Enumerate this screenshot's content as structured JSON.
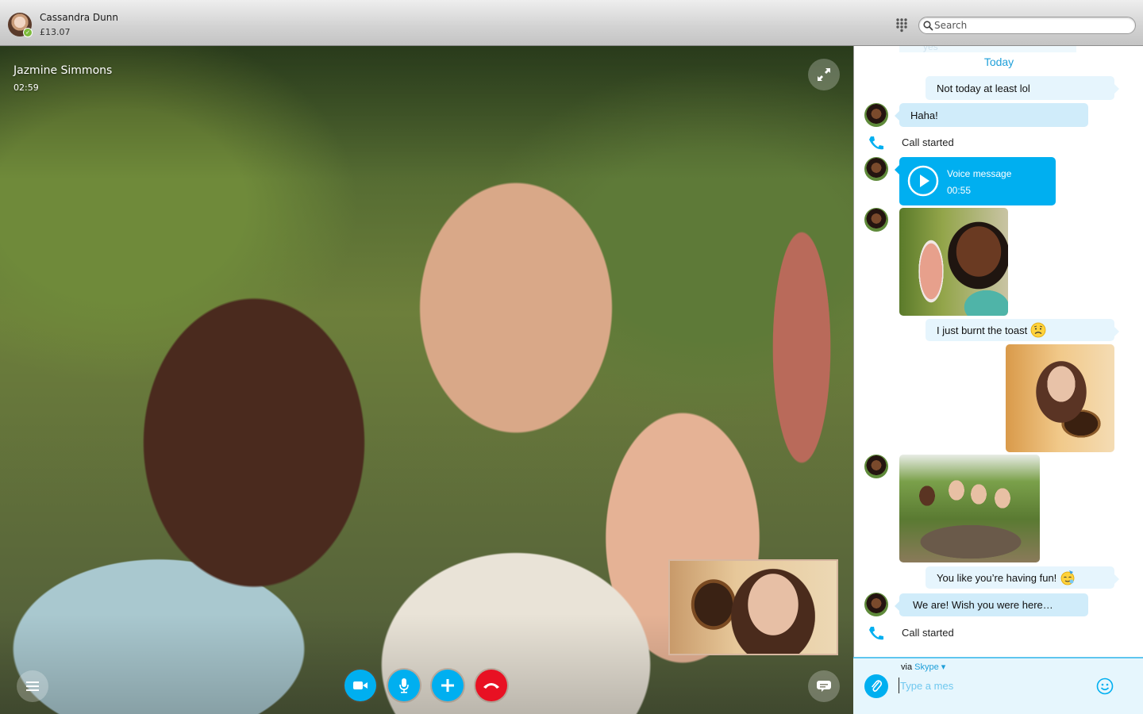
{
  "titlebar": {
    "user_name": "Cassandra Dunn",
    "credit": "£13.07",
    "presence": "online",
    "search": {
      "placeholder": "Search",
      "value": ""
    }
  },
  "call": {
    "contact_name": "Jazmine Simmons",
    "duration": "02:59",
    "controls": [
      {
        "name": "video",
        "icon": "video-camera-icon",
        "color": "#00aff0"
      },
      {
        "name": "mute",
        "icon": "microphone-icon",
        "color": "#00aff0"
      },
      {
        "name": "add",
        "icon": "plus-icon",
        "color": "#00aff0"
      },
      {
        "name": "end-call",
        "icon": "hang-up-icon",
        "color": "#e81123"
      }
    ]
  },
  "chat": {
    "previous_message_fragment": "yes",
    "date_separator": "Today",
    "messages": [
      {
        "type": "text",
        "direction": "out",
        "text": "Not today at least lol"
      },
      {
        "type": "text",
        "direction": "in",
        "text": "Haha!"
      },
      {
        "type": "call",
        "text": "Call started"
      },
      {
        "type": "voice",
        "direction": "in",
        "title": "Voice message",
        "duration": "00:55"
      },
      {
        "type": "photo",
        "direction": "in",
        "description": "woman holding champagne glass"
      },
      {
        "type": "text",
        "direction": "out",
        "text": "I just burnt the toast",
        "emoticon": "sad-face"
      },
      {
        "type": "photo",
        "direction": "out",
        "description": "woman holding burnt toast"
      },
      {
        "type": "photo",
        "direction": "in",
        "description": "four friends toasting"
      },
      {
        "type": "text",
        "direction": "out",
        "text": "You like you’re having fun!",
        "emoticon": "party-face"
      },
      {
        "type": "text",
        "direction": "in",
        "text": "We are! Wish you were here…"
      },
      {
        "type": "call",
        "text": "Call started"
      }
    ]
  },
  "composer": {
    "via_prefix": "via",
    "via_service": "Skype",
    "placeholder": "Type a mes",
    "value": ""
  },
  "colors": {
    "accent": "#00aff0",
    "link": "#1e9fd9",
    "end_call": "#e81123",
    "bubble_in": "#d0ecfa",
    "bubble_out": "#e6f5fd",
    "presence_online": "#7dbb3c"
  }
}
